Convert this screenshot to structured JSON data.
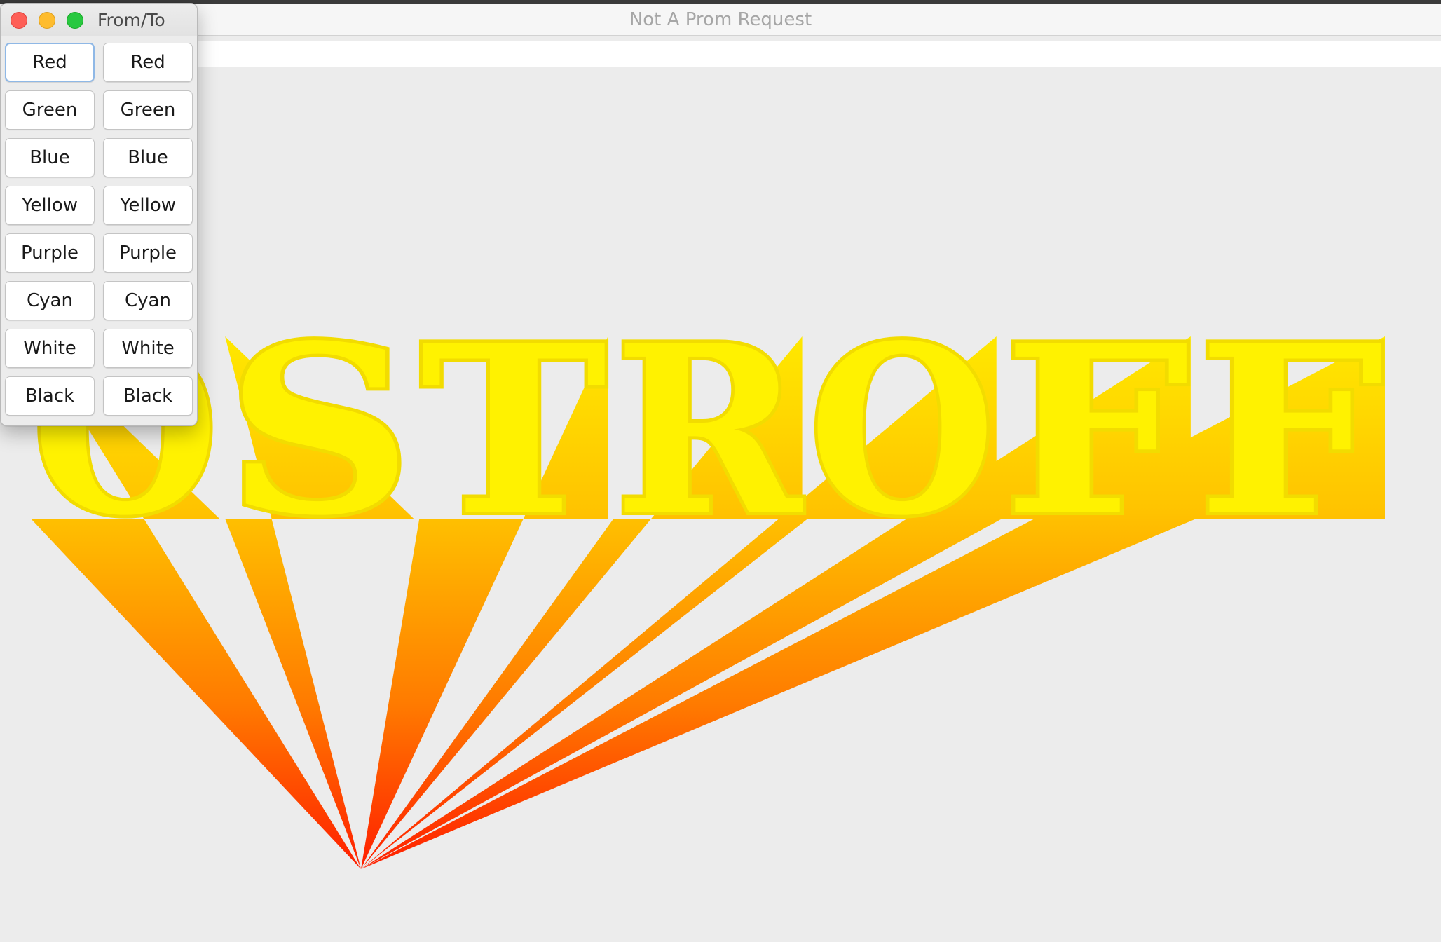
{
  "main_window": {
    "title": "Not A Prom Request"
  },
  "artwork": {
    "word": "OSTROFF",
    "gradient_start": "#ffee00",
    "gradient_end": "#ff1a00",
    "face_color": "#fff200",
    "outline_color": "#f2dc00",
    "background": "#ececec"
  },
  "palette_window": {
    "title": "From/To",
    "from_buttons": [
      "Red",
      "Green",
      "Blue",
      "Yellow",
      "Purple",
      "Cyan",
      "White",
      "Black"
    ],
    "to_buttons": [
      "Red",
      "Green",
      "Blue",
      "Yellow",
      "Purple",
      "Cyan",
      "White",
      "Black"
    ],
    "focused_button": "from-red"
  },
  "colors": {
    "close": "#fe5f57",
    "minimize": "#febc2e",
    "zoom": "#28c840",
    "focus_ring": "#8fb8e6"
  }
}
